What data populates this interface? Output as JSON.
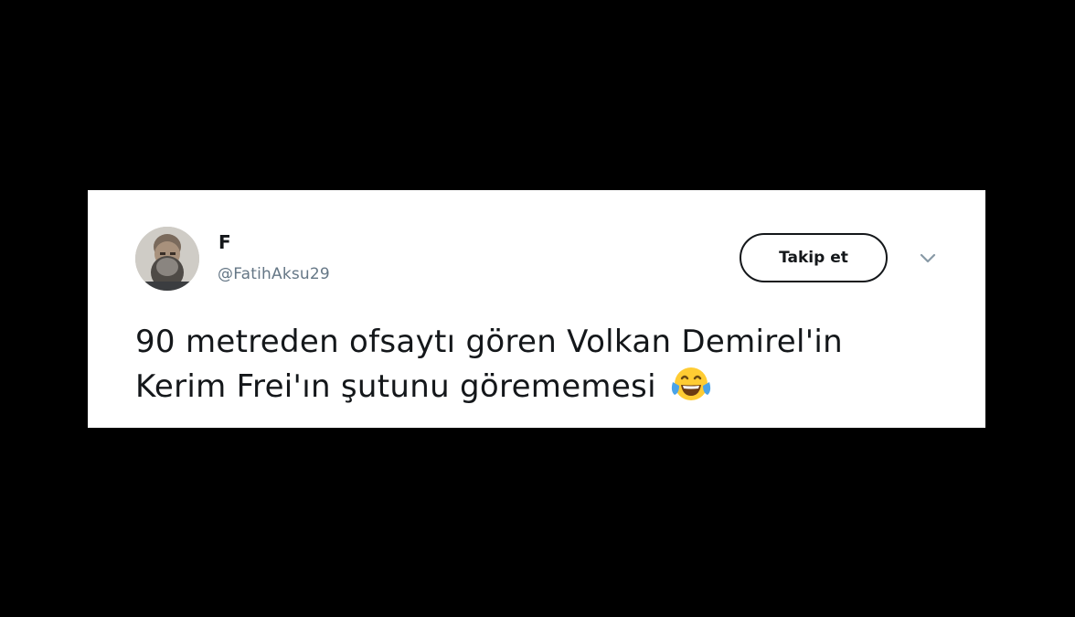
{
  "tweet": {
    "display_name": "F",
    "handle": "@FatihAksu29",
    "follow_label": "Takip et",
    "text_line1": "90 metreden ofsaytı gören Volkan Demirel'in",
    "text_line2": "Kerim Frei'ın şutunu görememesi",
    "emoji": "face-with-tears-of-joy"
  },
  "icons": {
    "more": "chevron-down-icon",
    "avatar": "avatar"
  },
  "colors": {
    "background": "#000000",
    "card": "#ffffff",
    "text": "#14171a",
    "handle": "#657786"
  }
}
